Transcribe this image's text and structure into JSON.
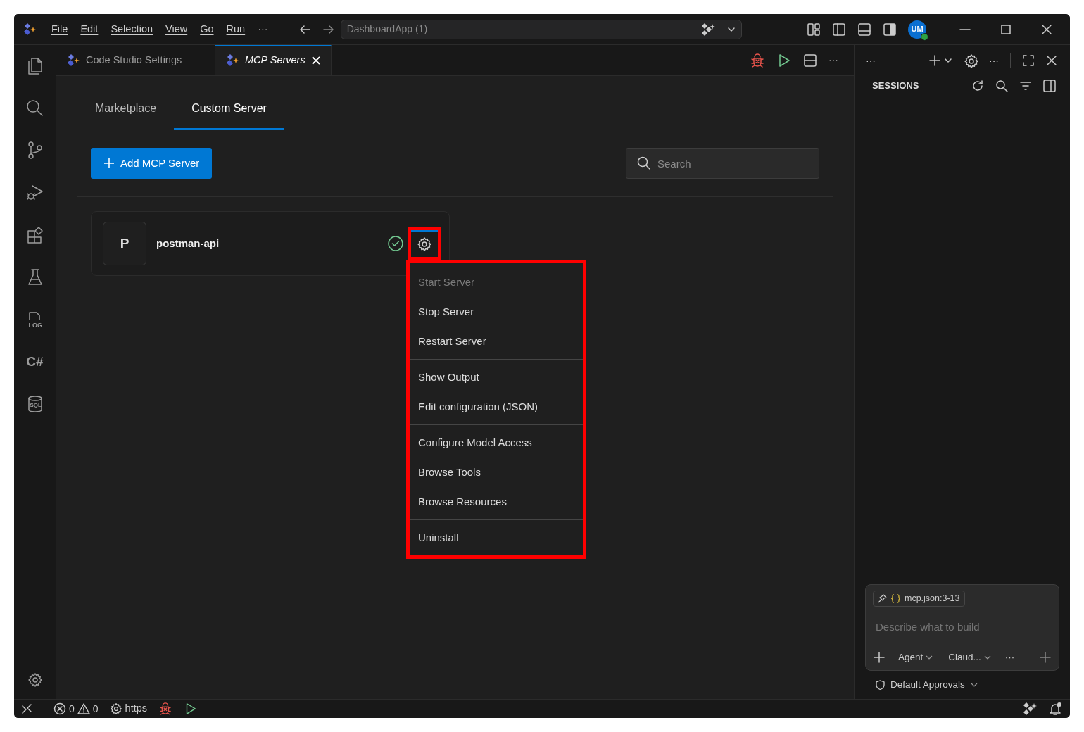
{
  "title_bar": {
    "menu": [
      "File",
      "Edit",
      "Selection",
      "View",
      "Go",
      "Run",
      "···"
    ],
    "command_center": "DashboardApp (1)",
    "avatar": "UM"
  },
  "activity_bar": [
    {
      "kind": "files"
    },
    {
      "kind": "search"
    },
    {
      "kind": "source-control"
    },
    {
      "kind": "run-debug"
    },
    {
      "kind": "extensions"
    },
    {
      "kind": "testing"
    },
    {
      "kind": "log",
      "label": "LOG"
    },
    {
      "kind": "csharp",
      "label": "C#"
    },
    {
      "kind": "database",
      "label": "SQL"
    }
  ],
  "tabs": [
    {
      "label": "Code Studio Settings",
      "selected": false
    },
    {
      "label": "MCP Servers",
      "selected": true
    }
  ],
  "sub_tabs": [
    {
      "label": "Marketplace",
      "selected": false
    },
    {
      "label": "Custom Server",
      "selected": true
    }
  ],
  "editor_more": "···",
  "add_button": "Add MCP Server",
  "search": {
    "placeholder": "Search"
  },
  "servers": [
    {
      "initial": "P",
      "name": "postman-api",
      "running": true,
      "settings_highlighted": true
    }
  ],
  "context_menu": {
    "highlighted": true,
    "groups": [
      [
        {
          "label": "Start Server",
          "disabled": true
        },
        {
          "label": "Stop Server",
          "disabled": false
        },
        {
          "label": "Restart Server",
          "disabled": false
        }
      ],
      [
        {
          "label": "Show Output",
          "disabled": false
        },
        {
          "label": "Edit configuration (JSON)",
          "disabled": false
        }
      ],
      [
        {
          "label": "Configure Model Access",
          "disabled": false
        },
        {
          "label": "Browse Tools",
          "disabled": false
        },
        {
          "label": "Browse Resources",
          "disabled": false
        }
      ],
      [
        {
          "label": "Uninstall",
          "disabled": false
        }
      ]
    ]
  },
  "sessions": {
    "header_more": [
      "···",
      "···"
    ],
    "title": "SESSIONS",
    "chat": {
      "attachment": "mcp.json:3-13",
      "placeholder": "Describe what to build",
      "mode": "Agent",
      "model": "Claud...",
      "more": "···"
    },
    "approvals": "Default Approvals"
  },
  "status_bar": {
    "errors": "0",
    "warnings": "0",
    "task": "https"
  }
}
